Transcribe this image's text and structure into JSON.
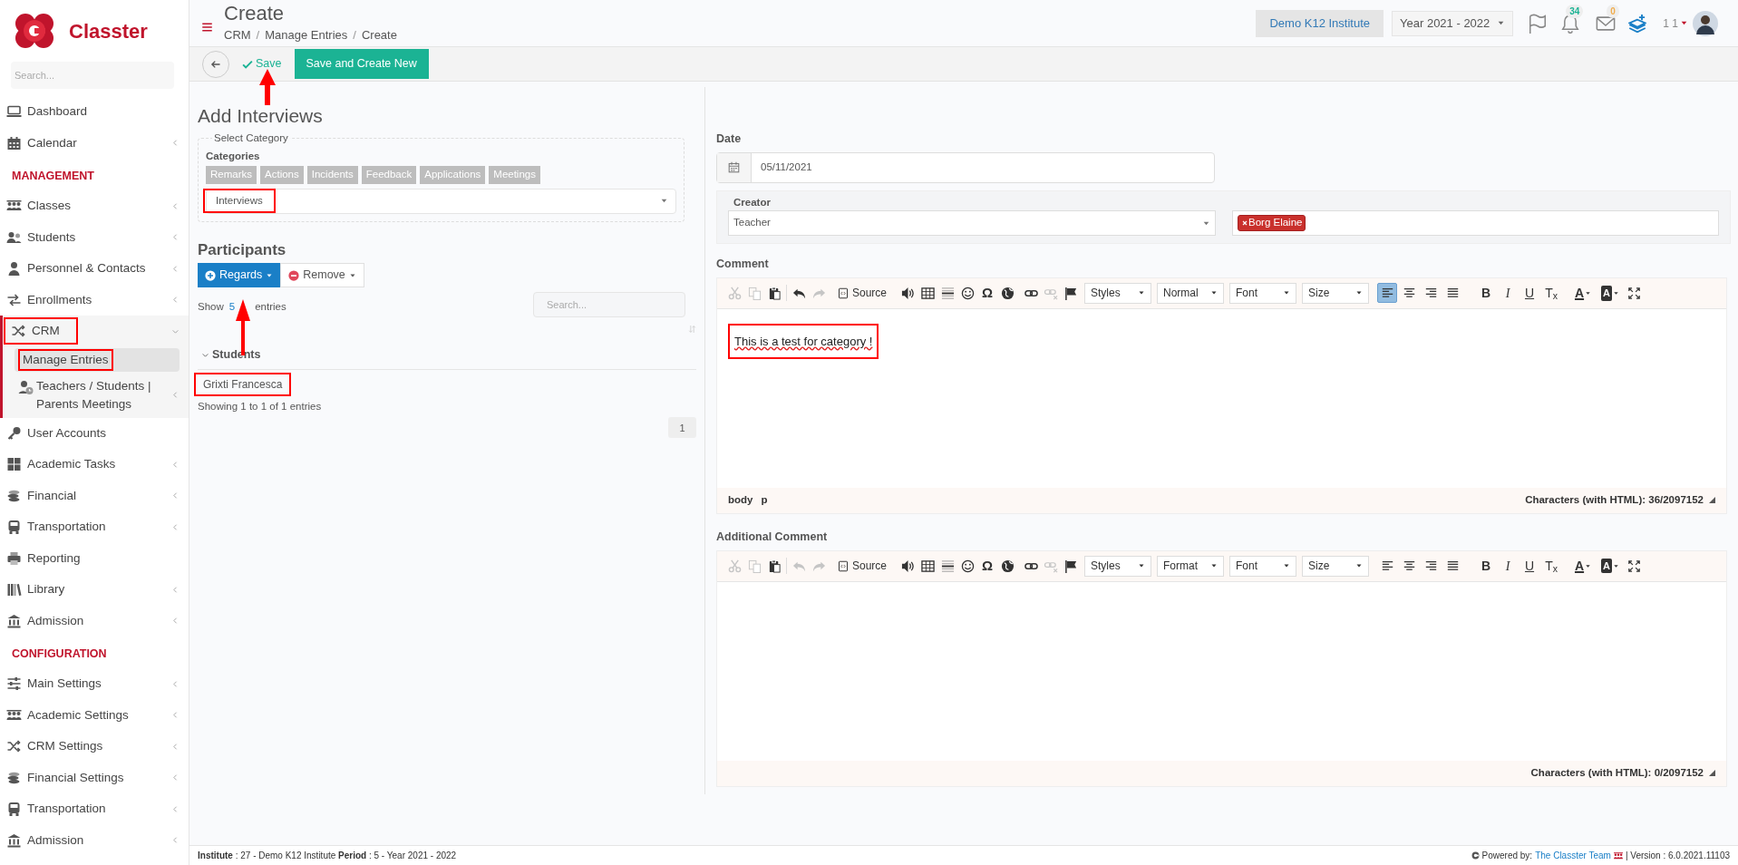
{
  "sidebar": {
    "logo_text": "Classter",
    "search_placeholder": "Search...",
    "entries": [
      {
        "kind": "item",
        "label": "Dashboard",
        "has_submenu": false,
        "expanded": false,
        "highlighted": false
      },
      {
        "kind": "item",
        "label": "Calendar",
        "has_submenu": true,
        "expanded": false,
        "highlighted": false
      },
      {
        "kind": "heading",
        "label": "MANAGEMENT"
      },
      {
        "kind": "item",
        "label": "Classes",
        "has_submenu": true,
        "expanded": false,
        "highlighted": false
      },
      {
        "kind": "item",
        "label": "Students",
        "has_submenu": true,
        "expanded": false,
        "highlighted": false
      },
      {
        "kind": "item",
        "label": "Personnel & Contacts",
        "has_submenu": true,
        "expanded": false,
        "highlighted": false
      },
      {
        "kind": "item",
        "label": "Enrollments",
        "has_submenu": true,
        "expanded": false,
        "highlighted": false
      },
      {
        "kind": "item",
        "label": "CRM",
        "has_submenu": true,
        "expanded": true,
        "highlighted": true,
        "children": [
          {
            "label": "Manage Entries",
            "selected": true,
            "highlighted": true,
            "has_submenu": false
          },
          {
            "label": "Teachers / Students | Parents Meetings",
            "selected": false,
            "highlighted": false,
            "has_submenu": true
          }
        ]
      },
      {
        "kind": "item",
        "label": "User Accounts",
        "has_submenu": false,
        "expanded": false,
        "highlighted": false
      },
      {
        "kind": "item",
        "label": "Academic Tasks",
        "has_submenu": true,
        "expanded": false,
        "highlighted": false
      },
      {
        "kind": "item",
        "label": "Financial",
        "has_submenu": true,
        "expanded": false,
        "highlighted": false
      },
      {
        "kind": "item",
        "label": "Transportation",
        "has_submenu": true,
        "expanded": false,
        "highlighted": false
      },
      {
        "kind": "item",
        "label": "Reporting",
        "has_submenu": false,
        "expanded": false,
        "highlighted": false
      },
      {
        "kind": "item",
        "label": "Library",
        "has_submenu": true,
        "expanded": false,
        "highlighted": false
      },
      {
        "kind": "item",
        "label": "Admission",
        "has_submenu": true,
        "expanded": false,
        "highlighted": false
      },
      {
        "kind": "heading",
        "label": "CONFIGURATION"
      },
      {
        "kind": "item",
        "label": "Main Settings",
        "has_submenu": true,
        "expanded": false,
        "highlighted": false
      },
      {
        "kind": "item",
        "label": "Academic Settings",
        "has_submenu": true,
        "expanded": false,
        "highlighted": false
      },
      {
        "kind": "item",
        "label": "CRM Settings",
        "has_submenu": true,
        "expanded": false,
        "highlighted": false
      },
      {
        "kind": "item",
        "label": "Financial Settings",
        "has_submenu": true,
        "expanded": false,
        "highlighted": false
      },
      {
        "kind": "item",
        "label": "Transportation",
        "has_submenu": true,
        "expanded": false,
        "highlighted": false
      },
      {
        "kind": "item",
        "label": "Admission",
        "has_submenu": true,
        "expanded": false,
        "highlighted": false
      }
    ]
  },
  "header": {
    "title": "Create",
    "breadcrumb": [
      "CRM",
      "Manage Entries",
      "Create"
    ],
    "separator": "/",
    "institute": "Demo K12 Institute",
    "year": "Year 2021 - 2022",
    "notifications": "34",
    "messages": "0",
    "user": "1 1"
  },
  "actions": {
    "save": "Save",
    "save_new": "Save and Create New"
  },
  "form": {
    "title": "Add Interviews",
    "legend": "Select Category",
    "categories_label": "Categories",
    "categories": [
      {
        "label": "Remarks"
      },
      {
        "label": "Actions"
      },
      {
        "label": "Incidents"
      },
      {
        "label": "Feedback"
      },
      {
        "label": "Applications"
      },
      {
        "label": "Meetings"
      }
    ],
    "category_value": "Interviews",
    "category_highlighted": true
  },
  "participants": {
    "title": "Participants",
    "add_button": "Regards",
    "remove_button": "Remove",
    "show_prefix": "Show",
    "show_value": "5",
    "show_suffix": "entries",
    "search_placeholder": "Search...",
    "group": "Students",
    "rows": [
      {
        "name": "Grixti Francesca",
        "highlighted": true
      }
    ],
    "info": "Showing 1 to 1 of 1 entries",
    "pages": [
      {
        "label": "1",
        "selected": true
      }
    ]
  },
  "date": {
    "label": "Date",
    "value": "05/11/2021"
  },
  "creator": {
    "label": "Creator",
    "role": "Teacher",
    "people": [
      {
        "name": "Borg Elaine"
      }
    ]
  },
  "editors": [
    {
      "label": "Comment",
      "source": "Source",
      "symbol": "Ω",
      "dropdowns": [
        "Styles",
        "Normal",
        "Font",
        "Size"
      ],
      "tools": [
        {
          "disabled": true
        },
        {
          "disabled": true
        },
        {
          "disabled": false
        },
        {
          "disabled": false
        },
        {
          "disabled": true
        },
        {
          "disabled": false
        },
        {
          "disabled": false
        },
        {
          "disabled": false
        },
        {
          "disabled": false
        },
        {
          "disabled": false
        },
        {
          "disabled": false
        },
        {
          "disabled": true
        },
        {
          "disabled": false
        }
      ],
      "align": [
        {
          "selected": true
        },
        {
          "selected": false
        },
        {
          "selected": false
        },
        {
          "selected": false
        }
      ],
      "format": [
        "B",
        "I",
        "U",
        "T$_{x}$"
      ],
      "colors": [
        "A",
        "A"
      ],
      "content": "This is a test for category !",
      "content_highlighted": true,
      "path": [
        "body",
        "p"
      ],
      "counter": "Characters (with HTML): 36/2097152"
    },
    {
      "label": "Additional Comment",
      "source": "Source",
      "symbol": "Ω",
      "dropdowns": [
        "Styles",
        "Format",
        "Font",
        "Size"
      ],
      "tools": [
        {
          "disabled": true
        },
        {
          "disabled": true
        },
        {
          "disabled": false
        },
        {
          "disabled": true
        },
        {
          "disabled": true
        },
        {
          "disabled": false
        },
        {
          "disabled": false
        },
        {
          "disabled": false
        },
        {
          "disabled": false
        },
        {
          "disabled": false
        },
        {
          "disabled": false
        },
        {
          "disabled": true
        },
        {
          "disabled": false
        }
      ],
      "align": [
        {
          "selected": false
        },
        {
          "selected": false
        },
        {
          "selected": false
        },
        {
          "selected": false
        }
      ],
      "format": [
        "B",
        "I",
        "U",
        "T$_{x}$"
      ],
      "colors": [
        "A",
        "A"
      ],
      "counter": "Characters (with HTML): 0/2097152"
    }
  ],
  "footer": {
    "info": "**Institute** : 27 - Demo K12 Institute **Period** : 5 - Year 2021 - 2022",
    "powered": "Powered by:",
    "team": "The Classter Team",
    "version": "| Version : 6.0.2021.11103"
  }
}
